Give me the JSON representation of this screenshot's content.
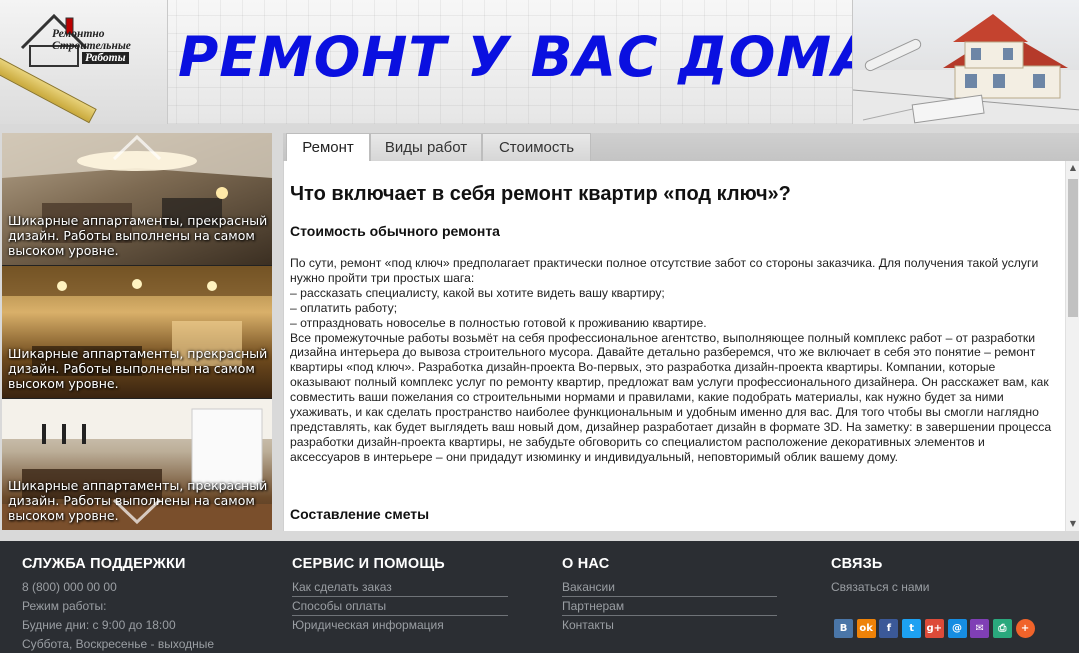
{
  "header": {
    "logo_lines": [
      "Ремонтно",
      "Строительные",
      "Работы"
    ],
    "site_title": "РЕМОНТ У ВАС ДОМА"
  },
  "slider": {
    "slides": [
      {
        "caption": "Шикарные аппартаменты, прекрасный дизайн. Работы выполнены на самом высоком уровне."
      },
      {
        "caption": "Шикарные аппартаменты, прекрасный дизайн. Работы выполнены на самом высоком уровне."
      },
      {
        "caption": "Шикарные аппартаменты, прекрасный дизайн. Работы выполнены на самом высоком уровне."
      }
    ]
  },
  "tabs": [
    {
      "label": "Ремонт",
      "active": true
    },
    {
      "label": "Виды работ",
      "active": false
    },
    {
      "label": "Стоимость",
      "active": false
    }
  ],
  "article": {
    "title": "Что включает в себя ремонт квартир «под ключ»?",
    "subheading_1": "Стоимость обычного ремонта",
    "paragraphs": [
      "По сути, ремонт «под ключ» предполагает практически полное отсутствие забот со стороны заказчика. Для получения такой услуги нужно пройти три простых шага:",
      " – рассказать специалисту, какой вы хотите видеть вашу квартиру;",
      " – оплатить работу;",
      " – отпраздновать новоселье в полностью готовой к проживанию квартире.",
      "Все промежуточные работы возьмёт на себя профессиональное агентство, выполняющее полный комплекс работ – от разработки дизайна интерьера до вывоза строительного мусора. Давайте детально разберемся, что же включает в себя это понятие – ремонт квартиры «под ключ». Разработка дизайн-проекта Во-первых, это разработка дизайн-проекта квартиры. Компании, которые оказывают полный комплекс услуг по ремонту квартир, предложат вам услуги профессионального дизайнера. Он расскажет вам, как совместить ваши пожелания со строительными нормами и правилами, какие подобрать материалы, как нужно будет за ними ухаживать, и как сделать пространство наиболее функциональным и удобным именно для вас. Для того чтобы вы смогли наглядно представлять, как будет выглядеть ваш новый дом, дизайнер разработает дизайн в формате 3D. На заметку: в завершении процесса разработки дизайн-проекта квартиры, не забудьте обговорить со специалистом расположение декоративных элементов и аксессуаров в интерьере – они придадут изюминку и индивидуальный, неповторимый облик вашему дому."
    ],
    "subheading_2": "Составление сметы"
  },
  "footer": {
    "support": {
      "title": "СЛУЖБА ПОДДЕРЖКИ",
      "phone": "8 (800) 000 00 00",
      "hours_label": "Режим работы:",
      "weekdays": "Будние дни: с 9:00 до 18:00",
      "weekend": "Суббота, Воскресенье - выходные"
    },
    "service": {
      "title": "СЕРВИС И ПОМОЩЬ",
      "links": [
        "Как сделать заказ",
        "Способы оплаты",
        "Юридическая информация"
      ]
    },
    "about": {
      "title": "О НАС",
      "links": [
        "Вакансии",
        "Партнерам",
        "Контакты"
      ]
    },
    "contact": {
      "title": "СВЯЗЬ",
      "link": "Связаться с нами"
    },
    "social": [
      {
        "name": "vk-icon",
        "glyph": "B",
        "color": "#4a76a8"
      },
      {
        "name": "odnoklassniki-icon",
        "glyph": "ok",
        "color": "#ee8208"
      },
      {
        "name": "facebook-icon",
        "glyph": "f",
        "color": "#3b5998"
      },
      {
        "name": "twitter-icon",
        "glyph": "t",
        "color": "#1da1f2"
      },
      {
        "name": "google-plus-icon",
        "glyph": "g+",
        "color": "#dd4b39"
      },
      {
        "name": "mailru-icon",
        "glyph": "@",
        "color": "#168de2"
      },
      {
        "name": "email-icon",
        "glyph": "✉",
        "color": "#7f3fb5"
      },
      {
        "name": "print-icon",
        "glyph": "⎙",
        "color": "#2aa87d"
      },
      {
        "name": "more-icon",
        "glyph": "+",
        "color": "#f0632a"
      }
    ]
  }
}
